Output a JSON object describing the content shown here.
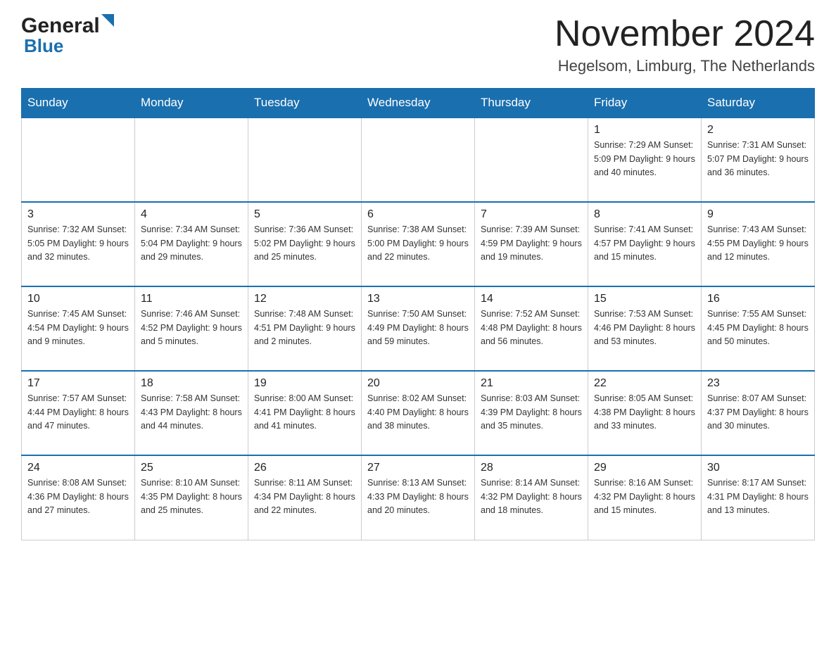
{
  "header": {
    "logo_general": "General",
    "logo_blue": "Blue",
    "month_title": "November 2024",
    "location": "Hegelsom, Limburg, The Netherlands"
  },
  "days_of_week": [
    "Sunday",
    "Monday",
    "Tuesday",
    "Wednesday",
    "Thursday",
    "Friday",
    "Saturday"
  ],
  "weeks": [
    [
      {
        "day": "",
        "info": ""
      },
      {
        "day": "",
        "info": ""
      },
      {
        "day": "",
        "info": ""
      },
      {
        "day": "",
        "info": ""
      },
      {
        "day": "",
        "info": ""
      },
      {
        "day": "1",
        "info": "Sunrise: 7:29 AM\nSunset: 5:09 PM\nDaylight: 9 hours\nand 40 minutes."
      },
      {
        "day": "2",
        "info": "Sunrise: 7:31 AM\nSunset: 5:07 PM\nDaylight: 9 hours\nand 36 minutes."
      }
    ],
    [
      {
        "day": "3",
        "info": "Sunrise: 7:32 AM\nSunset: 5:05 PM\nDaylight: 9 hours\nand 32 minutes."
      },
      {
        "day": "4",
        "info": "Sunrise: 7:34 AM\nSunset: 5:04 PM\nDaylight: 9 hours\nand 29 minutes."
      },
      {
        "day": "5",
        "info": "Sunrise: 7:36 AM\nSunset: 5:02 PM\nDaylight: 9 hours\nand 25 minutes."
      },
      {
        "day": "6",
        "info": "Sunrise: 7:38 AM\nSunset: 5:00 PM\nDaylight: 9 hours\nand 22 minutes."
      },
      {
        "day": "7",
        "info": "Sunrise: 7:39 AM\nSunset: 4:59 PM\nDaylight: 9 hours\nand 19 minutes."
      },
      {
        "day": "8",
        "info": "Sunrise: 7:41 AM\nSunset: 4:57 PM\nDaylight: 9 hours\nand 15 minutes."
      },
      {
        "day": "9",
        "info": "Sunrise: 7:43 AM\nSunset: 4:55 PM\nDaylight: 9 hours\nand 12 minutes."
      }
    ],
    [
      {
        "day": "10",
        "info": "Sunrise: 7:45 AM\nSunset: 4:54 PM\nDaylight: 9 hours\nand 9 minutes."
      },
      {
        "day": "11",
        "info": "Sunrise: 7:46 AM\nSunset: 4:52 PM\nDaylight: 9 hours\nand 5 minutes."
      },
      {
        "day": "12",
        "info": "Sunrise: 7:48 AM\nSunset: 4:51 PM\nDaylight: 9 hours\nand 2 minutes."
      },
      {
        "day": "13",
        "info": "Sunrise: 7:50 AM\nSunset: 4:49 PM\nDaylight: 8 hours\nand 59 minutes."
      },
      {
        "day": "14",
        "info": "Sunrise: 7:52 AM\nSunset: 4:48 PM\nDaylight: 8 hours\nand 56 minutes."
      },
      {
        "day": "15",
        "info": "Sunrise: 7:53 AM\nSunset: 4:46 PM\nDaylight: 8 hours\nand 53 minutes."
      },
      {
        "day": "16",
        "info": "Sunrise: 7:55 AM\nSunset: 4:45 PM\nDaylight: 8 hours\nand 50 minutes."
      }
    ],
    [
      {
        "day": "17",
        "info": "Sunrise: 7:57 AM\nSunset: 4:44 PM\nDaylight: 8 hours\nand 47 minutes."
      },
      {
        "day": "18",
        "info": "Sunrise: 7:58 AM\nSunset: 4:43 PM\nDaylight: 8 hours\nand 44 minutes."
      },
      {
        "day": "19",
        "info": "Sunrise: 8:00 AM\nSunset: 4:41 PM\nDaylight: 8 hours\nand 41 minutes."
      },
      {
        "day": "20",
        "info": "Sunrise: 8:02 AM\nSunset: 4:40 PM\nDaylight: 8 hours\nand 38 minutes."
      },
      {
        "day": "21",
        "info": "Sunrise: 8:03 AM\nSunset: 4:39 PM\nDaylight: 8 hours\nand 35 minutes."
      },
      {
        "day": "22",
        "info": "Sunrise: 8:05 AM\nSunset: 4:38 PM\nDaylight: 8 hours\nand 33 minutes."
      },
      {
        "day": "23",
        "info": "Sunrise: 8:07 AM\nSunset: 4:37 PM\nDaylight: 8 hours\nand 30 minutes."
      }
    ],
    [
      {
        "day": "24",
        "info": "Sunrise: 8:08 AM\nSunset: 4:36 PM\nDaylight: 8 hours\nand 27 minutes."
      },
      {
        "day": "25",
        "info": "Sunrise: 8:10 AM\nSunset: 4:35 PM\nDaylight: 8 hours\nand 25 minutes."
      },
      {
        "day": "26",
        "info": "Sunrise: 8:11 AM\nSunset: 4:34 PM\nDaylight: 8 hours\nand 22 minutes."
      },
      {
        "day": "27",
        "info": "Sunrise: 8:13 AM\nSunset: 4:33 PM\nDaylight: 8 hours\nand 20 minutes."
      },
      {
        "day": "28",
        "info": "Sunrise: 8:14 AM\nSunset: 4:32 PM\nDaylight: 8 hours\nand 18 minutes."
      },
      {
        "day": "29",
        "info": "Sunrise: 8:16 AM\nSunset: 4:32 PM\nDaylight: 8 hours\nand 15 minutes."
      },
      {
        "day": "30",
        "info": "Sunrise: 8:17 AM\nSunset: 4:31 PM\nDaylight: 8 hours\nand 13 minutes."
      }
    ]
  ]
}
